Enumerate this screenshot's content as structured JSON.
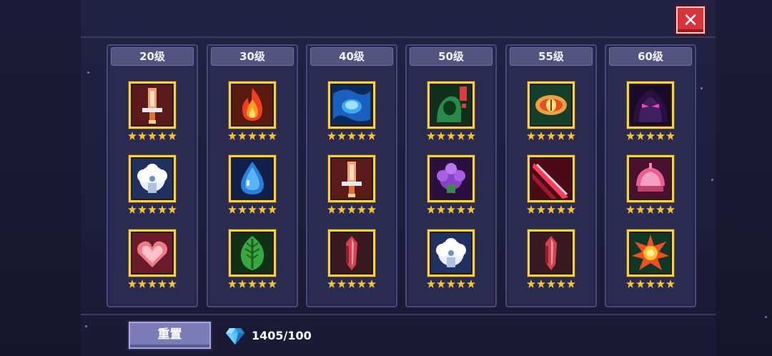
{
  "close_label": "✕",
  "columns": [
    {
      "level": "20级",
      "skills": [
        {
          "icon": "sword-icon",
          "stars": 5
        },
        {
          "icon": "white-puffball-icon",
          "stars": 5
        },
        {
          "icon": "heart-icon",
          "stars": 5
        }
      ]
    },
    {
      "level": "30级",
      "skills": [
        {
          "icon": "fire-icon",
          "stars": 5
        },
        {
          "icon": "water-drop-icon",
          "stars": 5
        },
        {
          "icon": "leaf-icon",
          "stars": 5
        }
      ]
    },
    {
      "level": "40级",
      "skills": [
        {
          "icon": "blue-vortex-gem-icon",
          "stars": 5
        },
        {
          "icon": "sword-icon",
          "stars": 5
        },
        {
          "icon": "red-crystal-icon",
          "stars": 5
        }
      ]
    },
    {
      "level": "50级",
      "skills": [
        {
          "icon": "green-hooded-figure-icon",
          "stars": 5
        },
        {
          "icon": "purple-puffball-icon",
          "stars": 5
        },
        {
          "icon": "white-puffball-icon",
          "stars": 5
        }
      ]
    },
    {
      "level": "55级",
      "skills": [
        {
          "icon": "eye-gem-icon",
          "stars": 5
        },
        {
          "icon": "red-slash-icon",
          "stars": 5
        },
        {
          "icon": "red-crystal-icon",
          "stars": 5
        }
      ]
    },
    {
      "level": "60级",
      "skills": [
        {
          "icon": "shadow-demon-icon",
          "stars": 5
        },
        {
          "icon": "pink-shell-icon",
          "stars": 5
        },
        {
          "icon": "sun-burst-icon",
          "stars": 5
        }
      ]
    }
  ],
  "footer": {
    "reset_label": "重置",
    "gem_count": "1405/100",
    "gem_icon": "diamond-icon"
  },
  "colors": {
    "frame": "#f2d24a",
    "star": "#f6c52c",
    "button": "#7b7bb8",
    "close": "#d8323a"
  }
}
